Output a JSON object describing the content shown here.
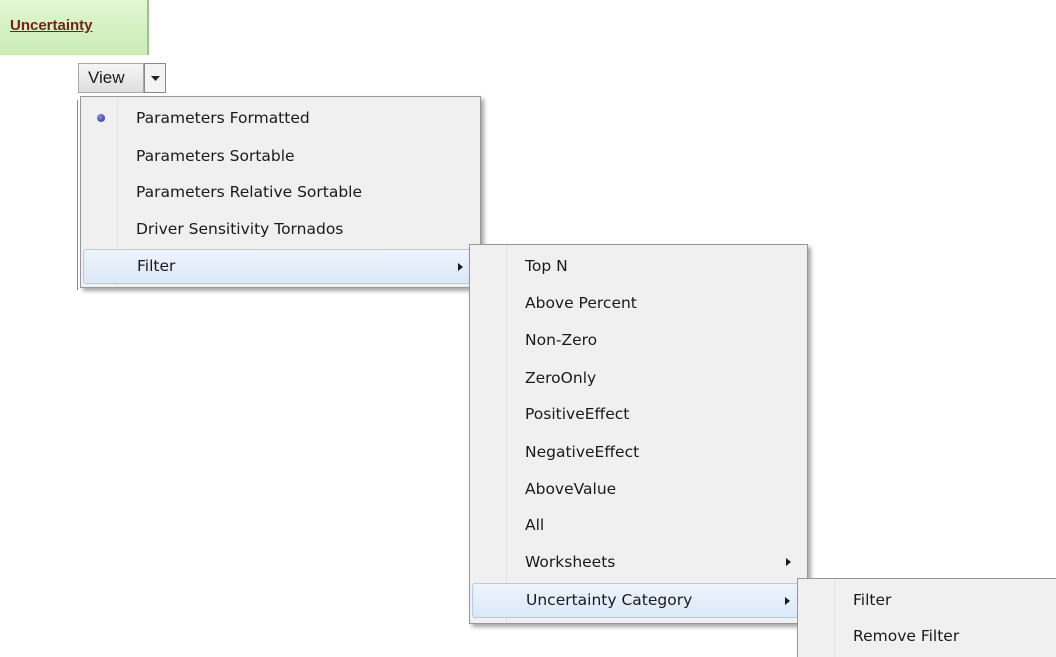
{
  "cell_link": {
    "label": "Uncertainty"
  },
  "view_button": {
    "label": "View"
  },
  "menu_main": {
    "items": [
      {
        "label": "Parameters Formatted",
        "selected": true
      },
      {
        "label": "Parameters Sortable"
      },
      {
        "label": "Parameters Relative Sortable"
      },
      {
        "label": "Driver Sensitivity Tornados"
      },
      {
        "label": "Filter",
        "has_submenu": true,
        "highlighted": true
      }
    ]
  },
  "menu_filter": {
    "items": [
      {
        "label": "Top N"
      },
      {
        "label": "Above Percent"
      },
      {
        "label": "Non-Zero"
      },
      {
        "label": "ZeroOnly"
      },
      {
        "label": "PositiveEffect"
      },
      {
        "label": "NegativeEffect"
      },
      {
        "label": "AboveValue"
      },
      {
        "label": "All"
      },
      {
        "label": "Worksheets",
        "has_submenu": true
      },
      {
        "label": "Uncertainty Category",
        "has_submenu": true,
        "highlighted": true
      }
    ]
  },
  "menu_category": {
    "items": [
      {
        "label": "Filter"
      },
      {
        "label": "Remove Filter"
      }
    ]
  },
  "colors": {
    "cell_bg": "#c9ecb3",
    "link": "#7a1e17",
    "highlight": "#dce8f8",
    "radio": "#2b2f9a"
  }
}
